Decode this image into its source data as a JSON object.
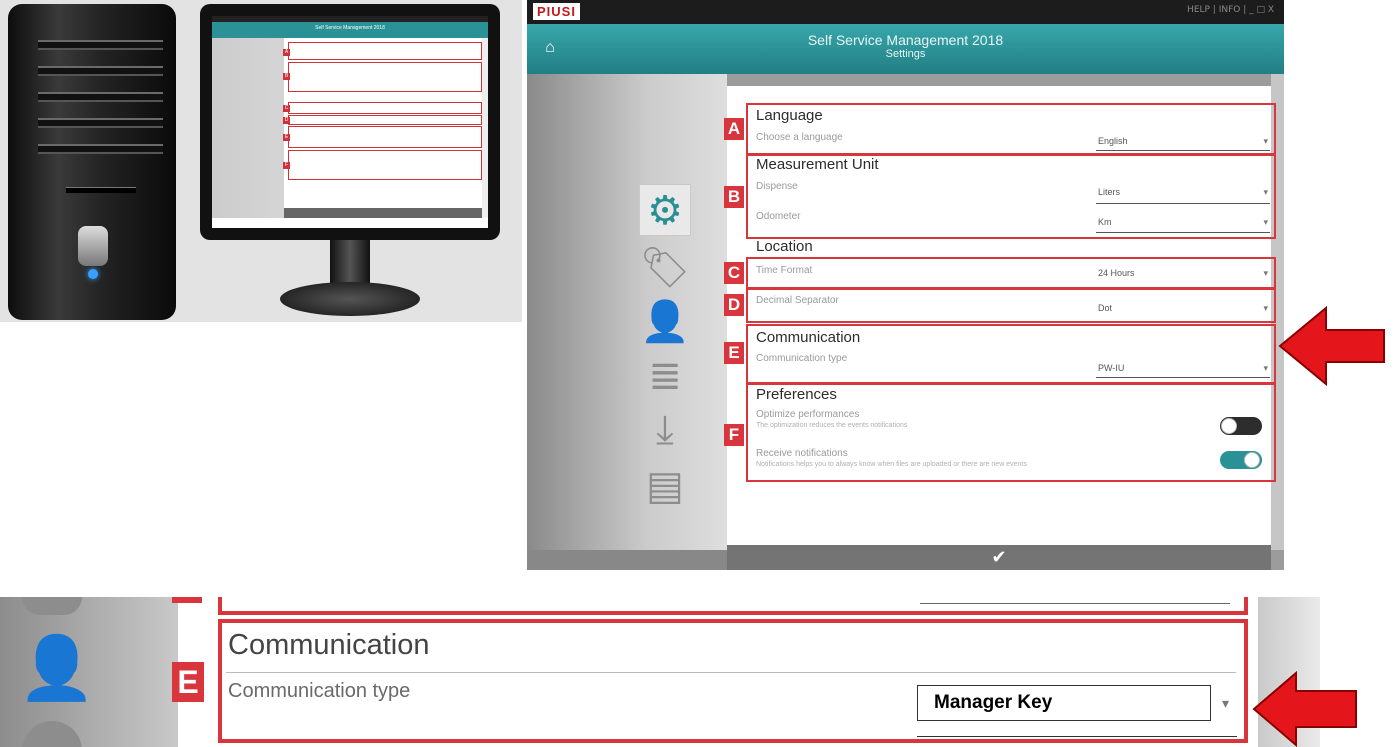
{
  "app": {
    "logo": "PIUSI",
    "titlebar_controls": "HELP | INFO | _ □ X",
    "title": "Self Service Management 2018",
    "subtitle": "Settings",
    "footer_confirm_icon": "checkmark-icon"
  },
  "sidebar": {
    "icons": [
      "gear-icon",
      "tag-icon",
      "user-icon",
      "database-icon",
      "download-icon",
      "archive-icon"
    ],
    "active": "gear-icon"
  },
  "sections": {
    "language": {
      "marker": "A",
      "title": "Language",
      "rows": [
        {
          "label": "Choose a language",
          "value": "English"
        }
      ]
    },
    "measurement": {
      "marker": "B",
      "title": "Measurement Unit",
      "rows": [
        {
          "label": "Dispense",
          "value": "Liters"
        },
        {
          "label": "Odometer",
          "value": "Km"
        }
      ]
    },
    "location": {
      "title": "Location",
      "time_marker": "C",
      "decimal_marker": "D",
      "rows": [
        {
          "label": "Time Format",
          "value": "24 Hours"
        },
        {
          "label": "Decimal Separator",
          "value": "Dot"
        }
      ]
    },
    "communication": {
      "marker": "E",
      "title": "Communication",
      "rows": [
        {
          "label": "Communication type",
          "value": "PW-IU"
        }
      ]
    },
    "preferences": {
      "marker": "F",
      "title": "Preferences",
      "rows": [
        {
          "label": "Optimize performances",
          "description": "The optimization reduces the events notifications",
          "state": "off"
        },
        {
          "label": "Receive notifications",
          "description": "Notifications helps you to always know when files are uploaded or there are new events",
          "state": "on"
        }
      ]
    }
  },
  "zoom": {
    "marker": "E",
    "title": "Communication",
    "label": "Communication type",
    "value": "Manager Key"
  },
  "colors": {
    "accent": "#2a9196",
    "highlight": "#d8353d",
    "arrow": "#e4161b"
  }
}
